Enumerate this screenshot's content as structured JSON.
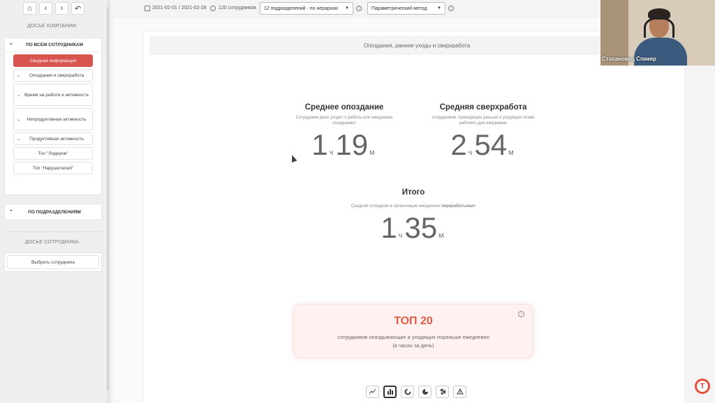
{
  "sidebar": {
    "nav": {
      "home_icon": "home-icon",
      "back_icon": "chevron-left-icon",
      "forward_icon": "chevron-right-icon",
      "undo_icon": "undo-icon"
    },
    "company_section_title": "ДОСЬЕ КОМПАНИИ:",
    "all_employees_label": "ПО ВСЕМ СОТРУДНИКАМ",
    "items": [
      {
        "label": "Сводная информация",
        "active": true
      },
      {
        "label": "Опоздания и сверхработа"
      },
      {
        "label": "Время на работе и активность"
      },
      {
        "label": "Непродуктивная активность"
      },
      {
        "label": "Продуктивная активность"
      },
      {
        "label": "Топ \"Лидеров\""
      },
      {
        "label": "Топ \"Нарушителей\""
      }
    ],
    "departments_label": "ПО ПОДРАЗДЕЛЕНИЯМ",
    "employee_section_title": "ДОСЬЕ СОТРУДНИКА:",
    "select_employee_label": "Выбрать сотрудника"
  },
  "topbar": {
    "date_range": "2021-02-01 / 2021-02-28",
    "employees_count": "120 сотрудников",
    "departments_select": "12 подразделений - по иерархии",
    "method_select": "Параметрический метод"
  },
  "panel": {
    "header": "Опоздания, ранние уходы и сверхработа",
    "late": {
      "title": "Среднее опоздание",
      "desc": "Сотрудники рано уходят с работы или ежедневно опаздывают",
      "hours": "1",
      "hours_unit": "ч",
      "minutes": "19",
      "minutes_unit": "м"
    },
    "overtime": {
      "title": "Средняя сверхработа",
      "desc": "сотрудников, приходящих раньше и уходящих позже рабочего дня ежедневно",
      "hours": "2",
      "hours_unit": "ч",
      "minutes": "54",
      "minutes_unit": "м"
    },
    "total": {
      "title": "Итого",
      "desc_prefix": "Средний сотрудник в организации ежедневно ",
      "desc_bold": "перерабатывает",
      "hours": "1",
      "hours_unit": "ч",
      "minutes": "35",
      "minutes_unit": "м"
    },
    "top_card": {
      "title": "ТОП 20",
      "line1": "сотрудников опаздывающих и уходящих пораньше ежедневно",
      "line2": "(в часах за день)"
    },
    "chart_tabs": [
      "line-chart-icon",
      "bar-chart-icon",
      "donut-chart-icon",
      "pie-chart-icon",
      "polar-chart-icon",
      "radar-chart-icon"
    ]
  },
  "webcam": {
    "name": "Стахановец Спикер"
  },
  "colors": {
    "accent_red": "#d9534f",
    "top_title": "#e05a44"
  }
}
